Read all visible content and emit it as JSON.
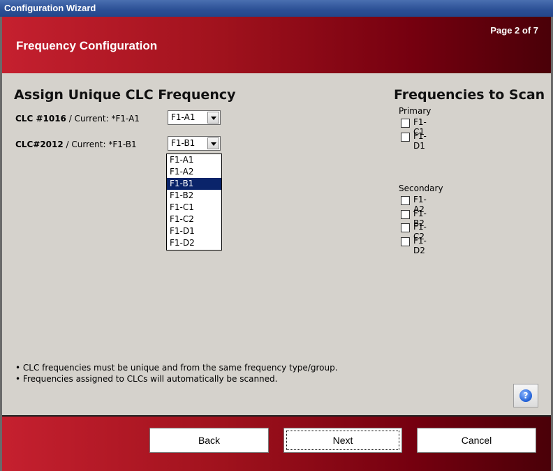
{
  "window": {
    "title": "Configuration Wizard"
  },
  "header": {
    "title": "Frequency Configuration",
    "page_indicator": "Page 2 of 7"
  },
  "assign": {
    "title": "Assign Unique CLC Frequency",
    "rows": [
      {
        "clc": "CLC #1016",
        "current": " / Current: *F1-A1",
        "selected": "F1-A1"
      },
      {
        "clc": "CLC#2012",
        "current": " / Current: *F1-B1",
        "selected": "F1-B1"
      }
    ],
    "dropdown_options": [
      "F1-A1",
      "F1-A2",
      "F1-B1",
      "F1-B2",
      "F1-C1",
      "F1-C2",
      "F1-D1",
      "F1-D2"
    ],
    "dropdown_highlighted": "F1-B1"
  },
  "scan": {
    "title": "Frequencies to Scan",
    "primary_label": "Primary",
    "primary": [
      {
        "label": "F1-C1",
        "checked": false
      },
      {
        "label": "F1-D1",
        "checked": false
      }
    ],
    "secondary_label": "Secondary",
    "secondary": [
      {
        "label": "F1-A2",
        "checked": false
      },
      {
        "label": "F1-B2",
        "checked": false
      },
      {
        "label": "F1-C2",
        "checked": false
      },
      {
        "label": "F1-D2",
        "checked": false
      }
    ]
  },
  "notes": [
    "• CLC frequencies must be unique and from the same frequency type/group.",
    "• Frequencies assigned to CLCs will automatically be scanned."
  ],
  "help": {
    "icon": "help-question-icon",
    "glyph": "?"
  },
  "buttons": {
    "back": "Back",
    "next": "Next",
    "cancel": "Cancel"
  },
  "colors": {
    "header_start": "#c5202f",
    "header_end": "#4a0008",
    "selection": "#0a246a",
    "titlebar": "#2b4f95"
  }
}
